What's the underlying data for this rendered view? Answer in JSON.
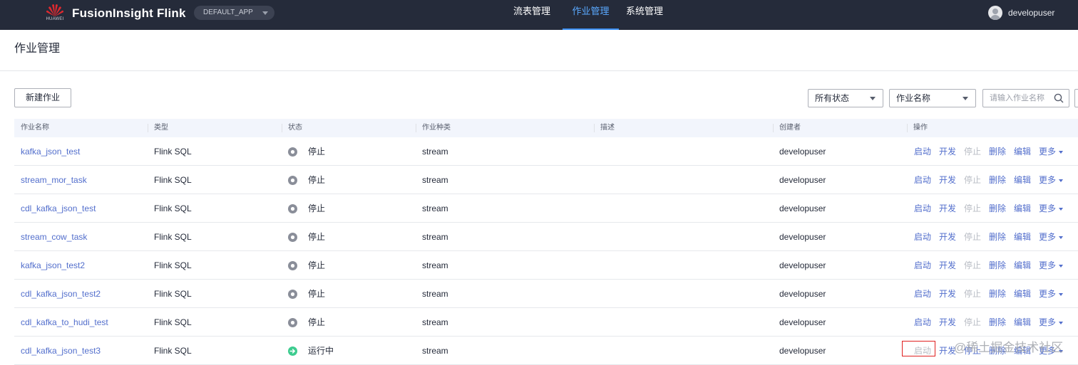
{
  "topbar": {
    "logo_sub": "HUAWEI",
    "brand": "FusionInsight Flink",
    "app_select": "DEFAULT_APP",
    "nav": [
      "流表管理",
      "作业管理",
      "系统管理"
    ],
    "active_nav": 1,
    "username": "developuser"
  },
  "page": {
    "title": "作业管理"
  },
  "toolbar": {
    "new_button": "新建作业",
    "status_filter": "所有状态",
    "field_filter": "作业名称",
    "search_placeholder": "请输入作业名称"
  },
  "table": {
    "headers": [
      "作业名称",
      "类型",
      "状态",
      "作业种类",
      "描述",
      "创建者",
      "操作"
    ],
    "rows": [
      {
        "name": "kafka_json_test",
        "type": "Flink SQL",
        "status": "停止",
        "running": false,
        "kind": "stream",
        "desc": "",
        "creator": "developuser"
      },
      {
        "name": "stream_mor_task",
        "type": "Flink SQL",
        "status": "停止",
        "running": false,
        "kind": "stream",
        "desc": "",
        "creator": "developuser"
      },
      {
        "name": "cdl_kafka_json_test",
        "type": "Flink SQL",
        "status": "停止",
        "running": false,
        "kind": "stream",
        "desc": "",
        "creator": "developuser"
      },
      {
        "name": "stream_cow_task",
        "type": "Flink SQL",
        "status": "停止",
        "running": false,
        "kind": "stream",
        "desc": "",
        "creator": "developuser"
      },
      {
        "name": "kafka_json_test2",
        "type": "Flink SQL",
        "status": "停止",
        "running": false,
        "kind": "stream",
        "desc": "",
        "creator": "developuser"
      },
      {
        "name": "cdl_kafka_json_test2",
        "type": "Flink SQL",
        "status": "停止",
        "running": false,
        "kind": "stream",
        "desc": "",
        "creator": "developuser"
      },
      {
        "name": "cdl_kafka_to_hudi_test",
        "type": "Flink SQL",
        "status": "停止",
        "running": false,
        "kind": "stream",
        "desc": "",
        "creator": "developuser"
      },
      {
        "name": "cdl_kafka_json_test3",
        "type": "Flink SQL",
        "status": "运行中",
        "running": true,
        "kind": "stream",
        "desc": "",
        "creator": "developuser"
      }
    ],
    "actions": [
      "启动",
      "开发",
      "停止",
      "删除",
      "编辑",
      "更多"
    ]
  },
  "colors": {
    "nav_bg": "#252b3a",
    "accent": "#526ecc",
    "running": "#3dcc8f",
    "stopped": "#8a8e99",
    "highlight": "#e02020"
  },
  "watermark": "@稀土掘金技术社区"
}
